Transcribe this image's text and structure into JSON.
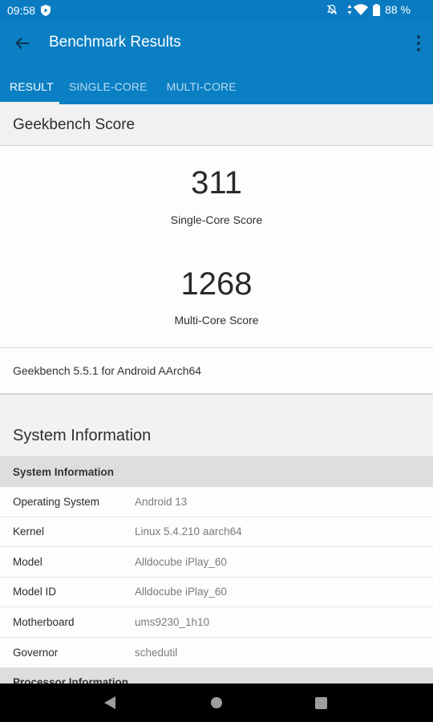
{
  "status_bar": {
    "time": "09:58",
    "battery": "88 %",
    "icons": [
      "shield-play-icon",
      "notifications-off-icon",
      "data-arrows-icon",
      "wifi-icon",
      "battery-icon"
    ]
  },
  "app_bar": {
    "title": "Benchmark Results",
    "back_icon": "arrow-left-icon",
    "menu_icon": "more-vert-icon"
  },
  "tabs": [
    {
      "label": "RESULT",
      "active": true
    },
    {
      "label": "SINGLE-CORE",
      "active": false
    },
    {
      "label": "MULTI-CORE",
      "active": false
    }
  ],
  "geekbench_score": {
    "header": "Geekbench Score",
    "single_core": {
      "value": "311",
      "label": "Single-Core Score"
    },
    "multi_core": {
      "value": "1268",
      "label": "Multi-Core Score"
    },
    "version": "Geekbench 5.5.1 for Android AArch64"
  },
  "system_information": {
    "title": "System Information",
    "group_header": "System Information",
    "rows": [
      {
        "key": "Operating System",
        "value": "Android 13"
      },
      {
        "key": "Kernel",
        "value": "Linux 5.4.210 aarch64"
      },
      {
        "key": "Model",
        "value": "Alldocube iPlay_60"
      },
      {
        "key": "Model ID",
        "value": "Alldocube iPlay_60"
      },
      {
        "key": "Motherboard",
        "value": "ums9230_1h10"
      },
      {
        "key": "Governor",
        "value": "schedutil"
      }
    ],
    "next_group_header": "Processor Information"
  },
  "nav_bar": {
    "icons": [
      "nav-back-icon",
      "nav-home-icon",
      "nav-recents-icon"
    ]
  },
  "colors": {
    "primary": "#0a7fc3",
    "status_bar": "#0a7bc2",
    "tab_inactive": "#b9dcf2",
    "icon_dark": "#0d3556"
  }
}
